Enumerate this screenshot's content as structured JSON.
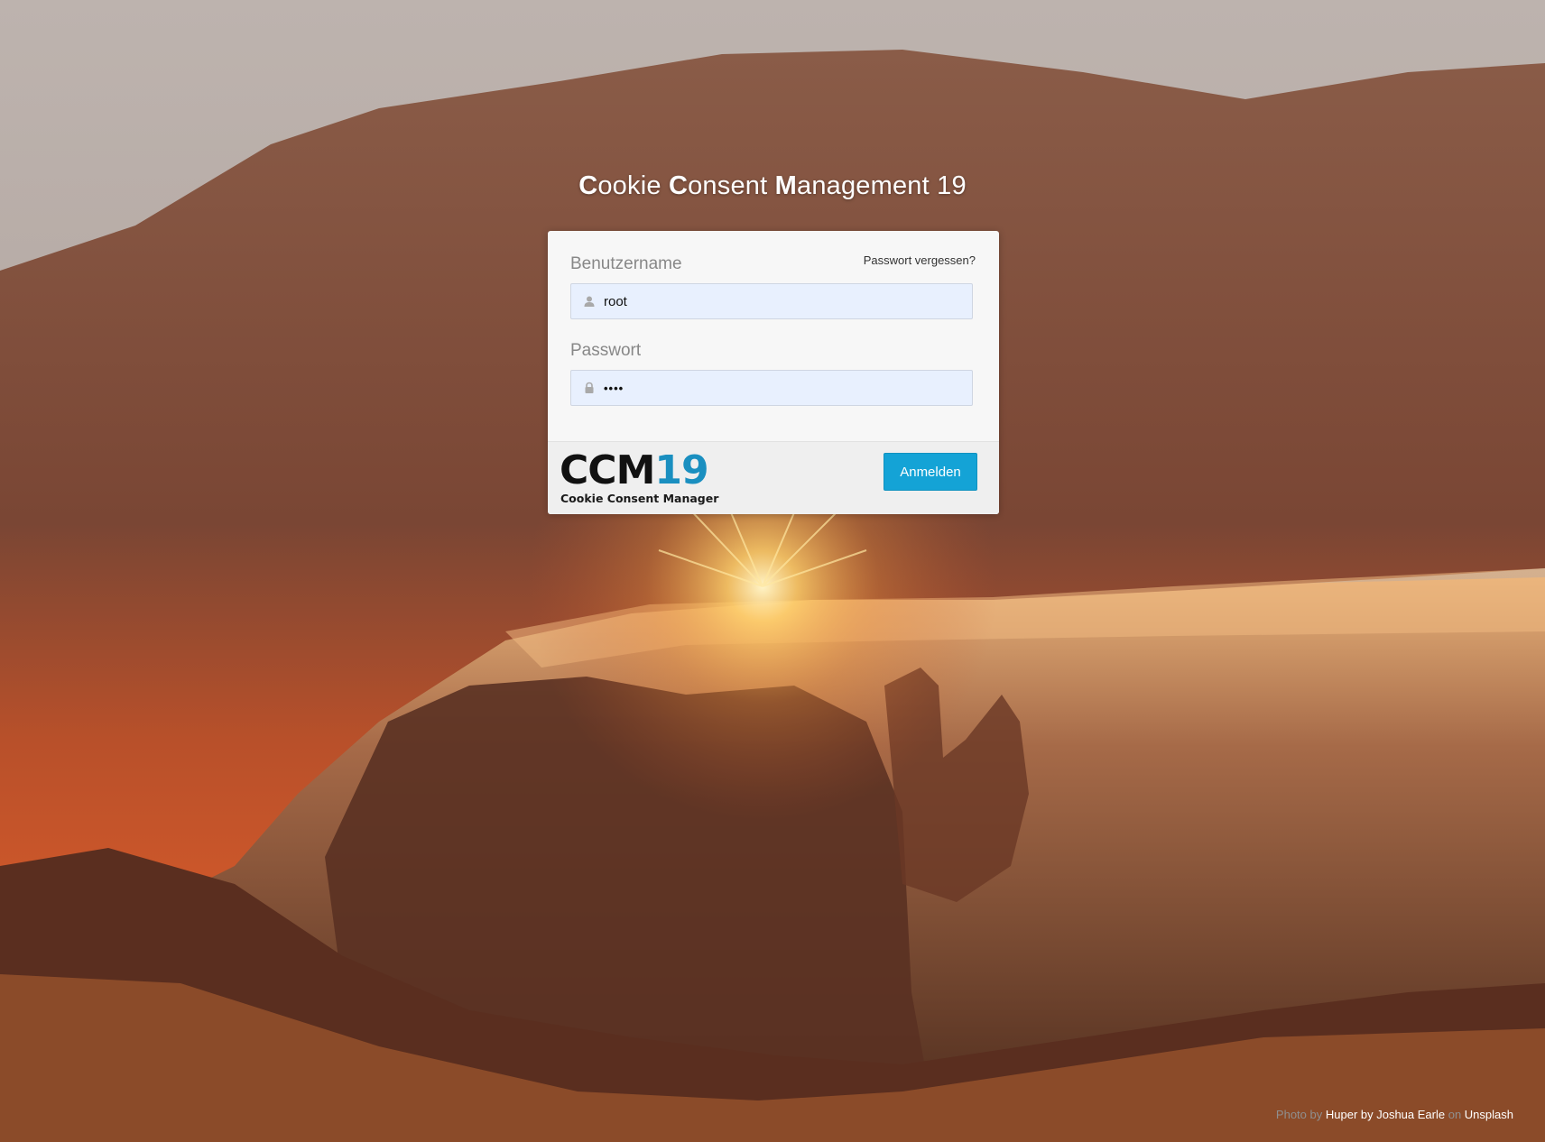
{
  "page": {
    "title_parts": [
      {
        "initial": "C",
        "rest": "ookie "
      },
      {
        "initial": "C",
        "rest": "onsent "
      },
      {
        "initial": "M",
        "rest": "anagement 19"
      }
    ]
  },
  "login": {
    "username_label": "Benutzername",
    "forgot_link": "Passwort vergessen?",
    "username_value": "root",
    "password_label": "Passwort",
    "password_value": "••••",
    "submit_label": "Anmelden"
  },
  "logo": {
    "mark_dark": "CCM",
    "mark_blue": "19",
    "subtitle": "Cookie Consent Manager"
  },
  "credit": {
    "prefix": "Photo by ",
    "author": "Huper by Joshua Earle",
    "middle": " on ",
    "source": "Unsplash"
  },
  "icons": {
    "username": "user-icon",
    "password": "lock-icon"
  },
  "colors": {
    "accent": "#14a3d6",
    "logo_blue": "#1a8fc0",
    "field_bg": "#e8f0fe"
  }
}
